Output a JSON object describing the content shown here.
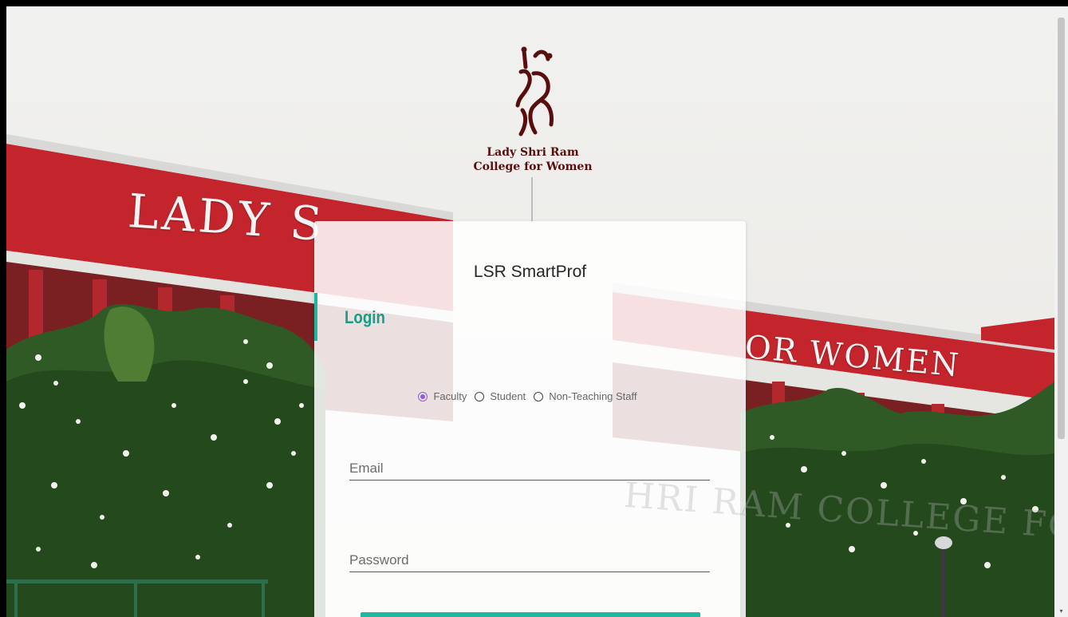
{
  "logo": {
    "line1": "Lady Shri Ram",
    "line2": "College for Women"
  },
  "background": {
    "sign_left": "LADY S",
    "sign_right": "OR WOMEN",
    "sign_ghost": "HRI RAM COLLEGE FO"
  },
  "card": {
    "app_title": "LSR SmartProf",
    "login_heading": "Login",
    "roles": [
      {
        "label": "Faculty",
        "checked": true
      },
      {
        "label": "Student",
        "checked": false
      },
      {
        "label": "Non-Teaching Staff",
        "checked": false
      }
    ],
    "email": {
      "placeholder": "Email",
      "value": ""
    },
    "password": {
      "placeholder": "Password",
      "value": ""
    }
  },
  "colors": {
    "accent": "#1fb79e",
    "radio_selected": "#8d5fd3",
    "building_red": "#c4252c",
    "logo_maroon": "#5a0d0d"
  },
  "icons": {
    "scroll_down": "▾"
  }
}
